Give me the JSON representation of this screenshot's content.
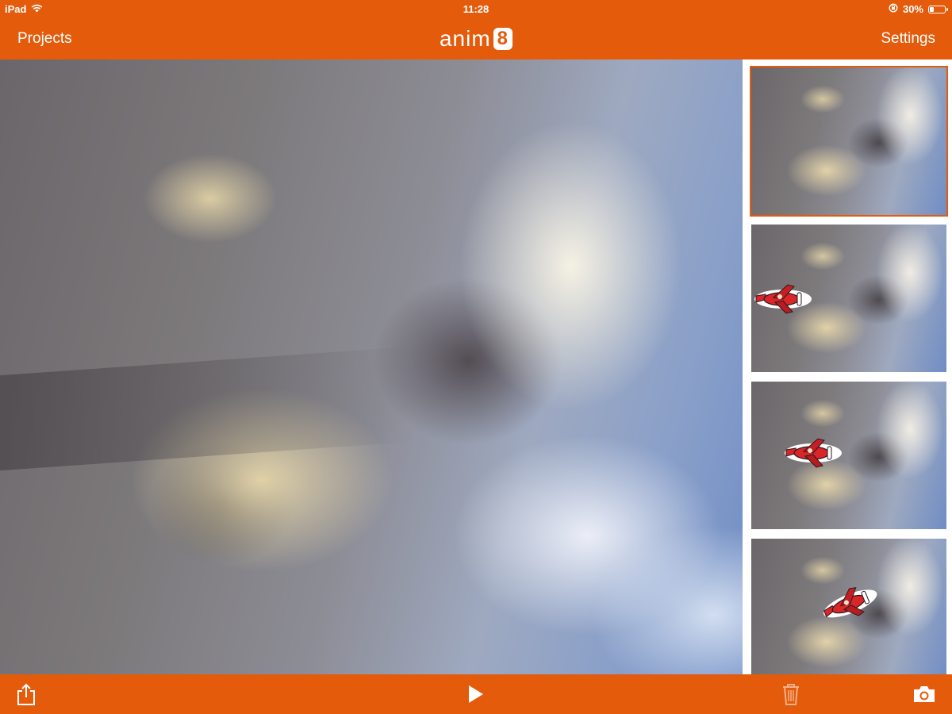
{
  "status_bar": {
    "device": "iPad",
    "time": "11:28",
    "battery": "30%",
    "battery_level": 0.3
  },
  "nav": {
    "projects_label": "Projects",
    "settings_label": "Settings",
    "app_name": "anim",
    "app_name_badge": "8"
  },
  "frames": [
    {
      "selected": true,
      "has_plane": false
    },
    {
      "selected": false,
      "has_plane": true
    },
    {
      "selected": false,
      "has_plane": true
    },
    {
      "selected": false,
      "has_plane": true
    }
  ],
  "toolbar": {
    "share_icon": "share-icon",
    "play_icon": "play-icon",
    "trash_icon": "trash-icon",
    "camera_icon": "camera-icon"
  },
  "colors": {
    "accent": "#e45b0c",
    "plane_red": "#d8262a"
  }
}
